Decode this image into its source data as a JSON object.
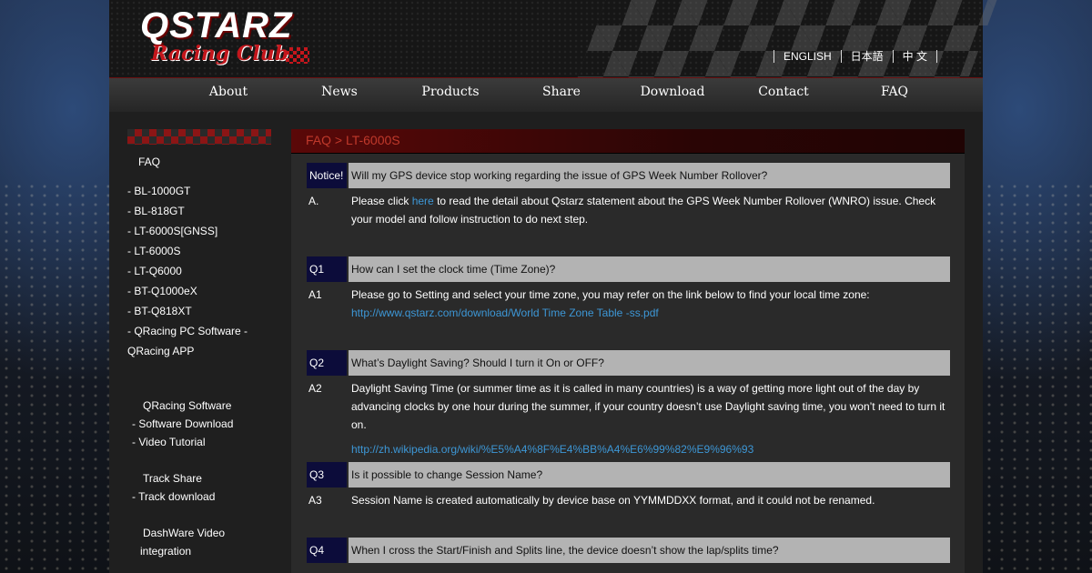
{
  "header": {
    "logo_main": "QSTARZ",
    "logo_sub": "Racing Club",
    "languages": [
      "ENGLISH",
      "日本語",
      "中 文"
    ]
  },
  "nav": [
    "About",
    "News",
    "Products",
    "Share",
    "Download",
    "Contact",
    "FAQ"
  ],
  "sidebar": {
    "title": "FAQ",
    "products": [
      "- BL-1000GT",
      "- BL-818GT",
      "- LT-6000S[GNSS]",
      "- LT-6000S",
      "- LT-Q6000",
      "- BT-Q1000eX",
      "- BT-Q818XT",
      "- QRacing PC Software -",
      "QRacing APP"
    ],
    "qracing_title": "QRacing Software",
    "qracing_links": [
      "- Software Download",
      "- Video Tutorial"
    ],
    "track_title": "Track Share",
    "track_links": [
      "- Track download"
    ],
    "dashware_title": "DashWare Video",
    "dashware_title2": "integration"
  },
  "breadcrumb": "FAQ > LT-6000S",
  "faq": {
    "notice": {
      "tag": "Notice!",
      "question": "Will my GPS device stop working regarding the issue of GPS Week Number Rollover?",
      "answer_tag": "A.",
      "answer_pre": "Please click ",
      "answer_link": "here",
      "answer_post": " to read the detail about Qstarz statement about the GPS Week Number Rollover (WNRO) issue. Check your model and follow instruction to do next step."
    },
    "q1": {
      "tag": "Q1",
      "question": "How can I set the clock time (Time Zone)?",
      "answer_tag": "A1",
      "answer": "Please go to Setting and select your time zone, you may refer on the link below to find your local time zone:",
      "link": "http://www.qstarz.com/download/World Time Zone Table -ss.pdf"
    },
    "q2": {
      "tag": "Q2",
      "question": "What’s Daylight Saving? Should I turn it On or OFF?",
      "answer_tag": "A2",
      "answer": "Daylight Saving Time (or summer time as it is called in many countries) is a way of getting more light out of the day by advancing clocks by one hour during the summer, if your country doesn’t use Daylight saving time, you won’t need to turn it on.",
      "link": "http://zh.wikipedia.org/wiki/%E5%A4%8F%E4%BB%A4%E6%99%82%E9%96%93"
    },
    "q3": {
      "tag": "Q3",
      "question": "Is it possible to change Session Name?",
      "answer_tag": "A3",
      "answer": "Session Name is created automatically by device base on YYMMDDXX format, and it could not be renamed."
    },
    "q4": {
      "tag": "Q4",
      "question": "When I cross the Start/Finish and Splits line, the device doesn’t show the lap/splits time?"
    }
  }
}
